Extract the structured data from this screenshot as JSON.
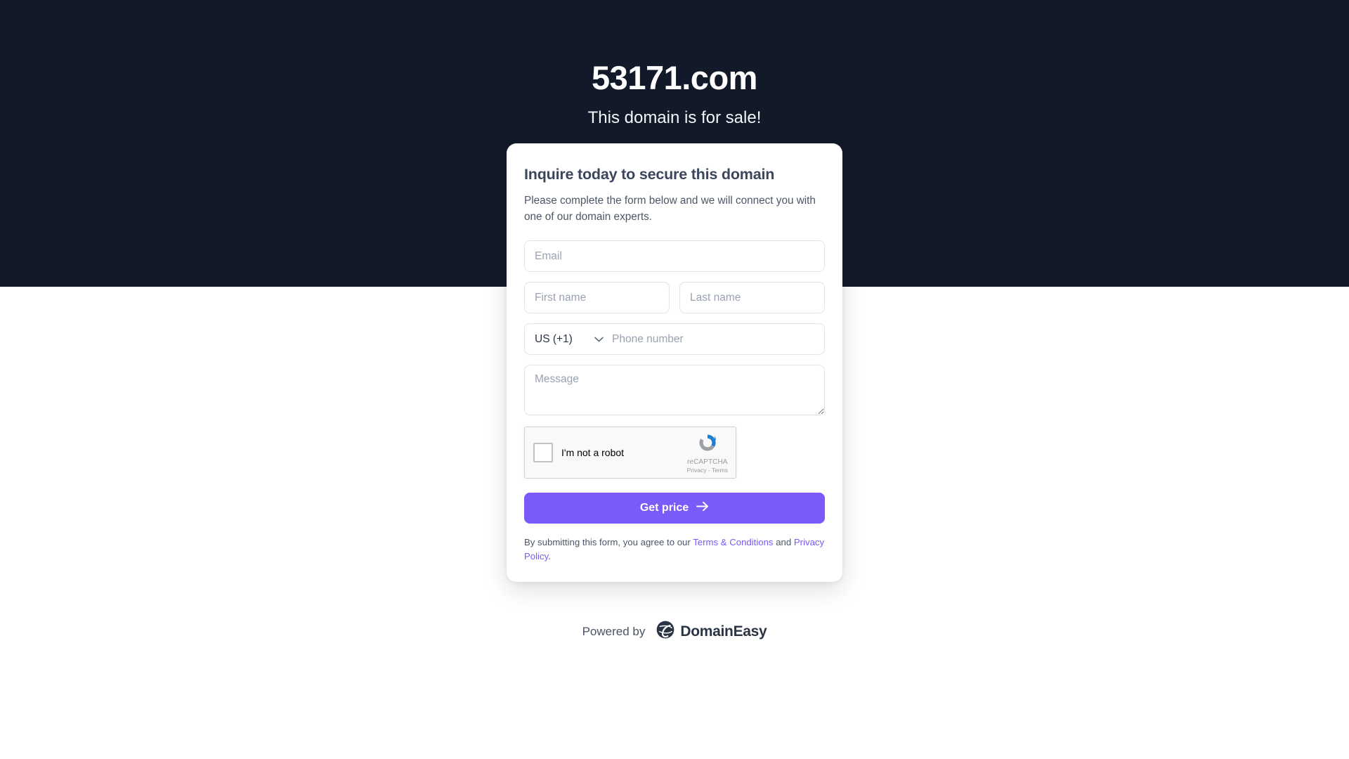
{
  "hero": {
    "domain_title": "53171.com",
    "subtitle": "This domain is for sale!",
    "background_color": "#121a2a"
  },
  "card": {
    "title": "Inquire today to secure this domain",
    "description": "Please complete the form below and we will connect you with one of our domain experts.",
    "form": {
      "email_placeholder": "Email",
      "email_value": "",
      "first_name_placeholder": "First name",
      "first_name_value": "",
      "last_name_placeholder": "Last name",
      "last_name_value": "",
      "country_code_selected": "US (+1)",
      "country_code_icon": "chevron-down-icon",
      "phone_placeholder": "Phone number",
      "phone_value": "",
      "message_placeholder": "Message",
      "message_value": ""
    },
    "recaptcha": {
      "checkbox_label": "I'm not a robot",
      "brand_name": "reCAPTCHA",
      "links": "Privacy - Terms",
      "logo_icon": "recaptcha-logo-icon",
      "logo_blue": "#1c7fd6",
      "logo_gray": "#9aa0a6"
    },
    "submit": {
      "label": "Get price",
      "icon": "arrow-right-icon",
      "color": "#7a5af8"
    },
    "legal": {
      "prefix": "By submitting this form, you agree to our ",
      "terms_link": "Terms & Conditions",
      "middle": " and ",
      "privacy_link": "Privacy Policy",
      "suffix": ".",
      "link_color": "#7a5af8"
    }
  },
  "footer": {
    "powered_by": "Powered by",
    "brand_name": "DomainEasy",
    "brand_icon": "domaineasy-logo-icon"
  }
}
